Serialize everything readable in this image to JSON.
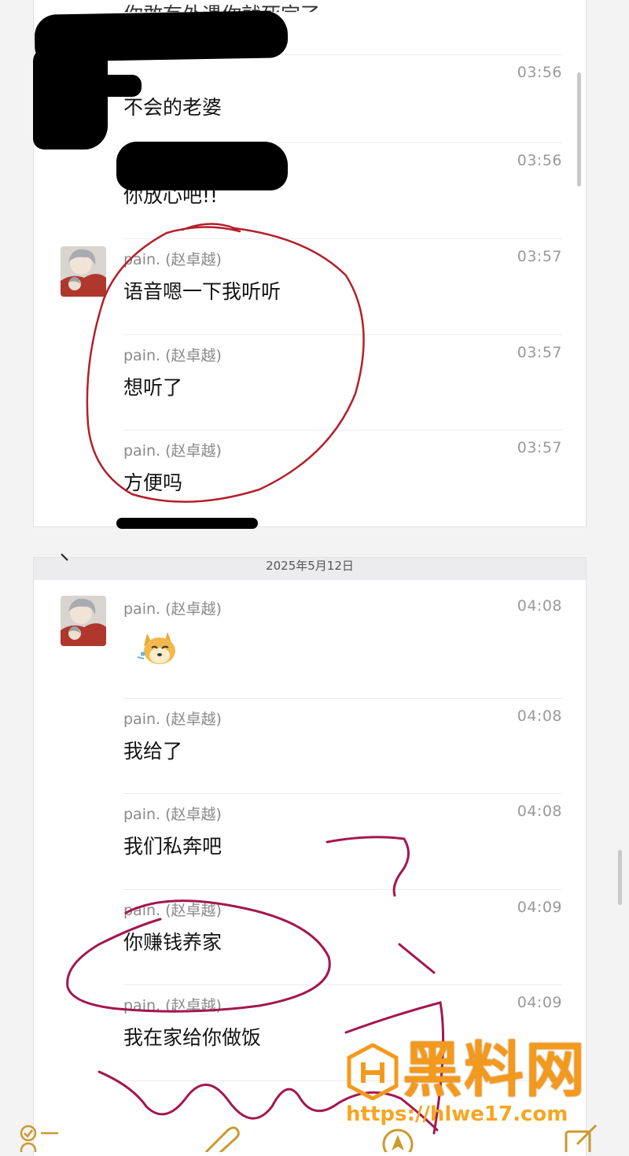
{
  "chat": {
    "panel1": {
      "top_text": "你敢有外遇你就死定了",
      "messages": [
        {
          "sender": "",
          "time": "03:56",
          "text": "不会的老婆"
        },
        {
          "sender": "",
          "time": "03:56",
          "text": "你放心吧!!"
        },
        {
          "sender": "pain. (赵卓越)",
          "time": "03:57",
          "text": "语音嗯一下我听听"
        },
        {
          "sender": "pain. (赵卓越)",
          "time": "03:57",
          "text": "想听了"
        },
        {
          "sender": "pain. (赵卓越)",
          "time": "03:57",
          "text": "方便吗"
        }
      ]
    },
    "panel2": {
      "date": "2025年5月12日",
      "messages": [
        {
          "sender": "pain. (赵卓越)",
          "time": "04:08",
          "text": ""
        },
        {
          "sender": "pain. (赵卓越)",
          "time": "04:08",
          "text": "我给了"
        },
        {
          "sender": "pain. (赵卓越)",
          "time": "04:08",
          "text": "我们私奔吧"
        },
        {
          "sender": "pain. (赵卓越)",
          "time": "04:09",
          "text": "你赚钱养家"
        },
        {
          "sender": "pain. (赵卓越)",
          "time": "04:09",
          "text": "我在家给你做饭"
        }
      ]
    }
  },
  "watermark": {
    "brand": "黑料网",
    "url": "https://hlwe17.com"
  },
  "colors": {
    "annotation_red": "#b3202a",
    "annotation_magenta": "#a3174f",
    "watermark_orange": "#f39a1c"
  }
}
